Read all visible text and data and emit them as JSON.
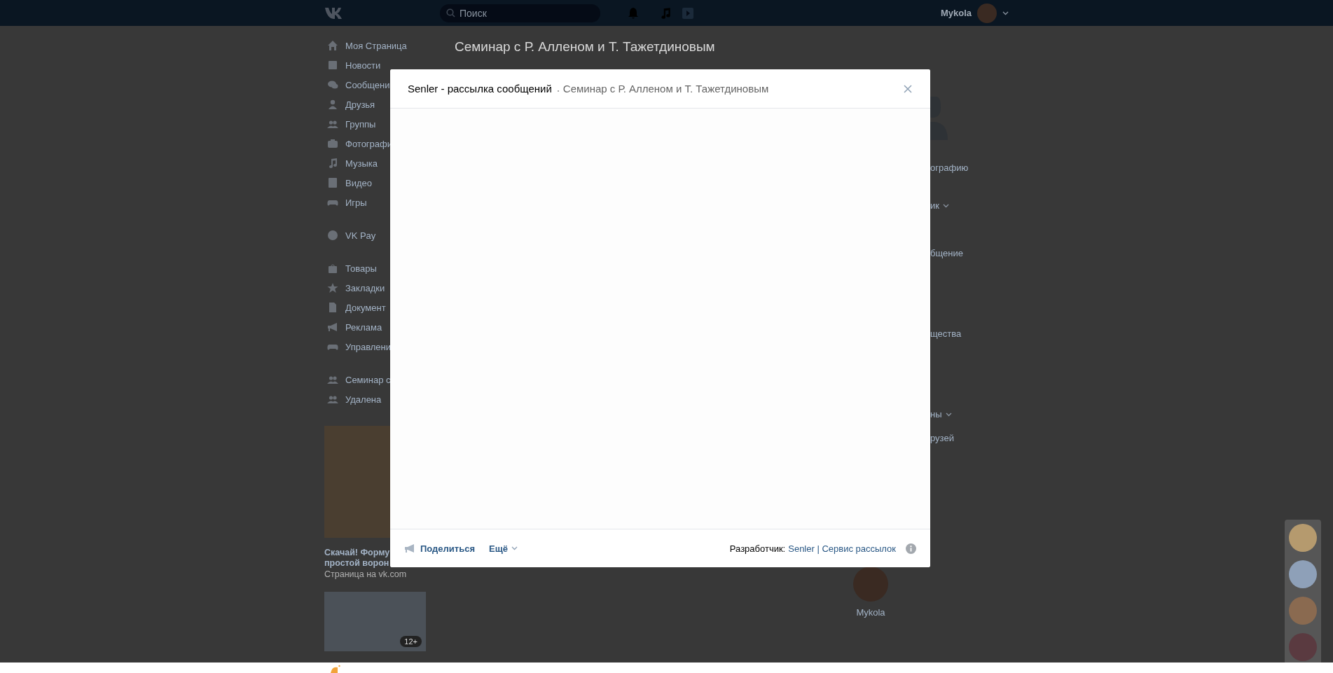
{
  "top_bar": {
    "search": {
      "placeholder": "Поиск"
    },
    "user_name": "Mykola"
  },
  "sidebar": {
    "groups": [
      {
        "items": [
          "Моя Страница",
          "Новости",
          "Сообщени",
          "Друзья",
          "Группы",
          "Фотографи",
          "Музыка",
          "Видео",
          "Игры"
        ]
      },
      {
        "items": [
          "VK Pay"
        ]
      },
      {
        "items": [
          "Товары",
          "Закладки",
          "Документ",
          "Реклама",
          "Управлени"
        ]
      },
      {
        "items": [
          "Семинар с",
          "Удалена"
        ]
      }
    ]
  },
  "ad": {
    "title_lines": [
      "Скачай! Форму",
      "простой ворон"
    ],
    "source": "Страница на vk.com"
  },
  "ad_2": {
    "badge": "12+"
  },
  "page_title": "Семинар с Р. Алленом и Т. Тажетдиновым",
  "right_column": {
    "items": [
      {
        "text": "ографию",
        "caret": false
      },
      {
        "text": "ик",
        "caret": true
      },
      {
        "text": "бщение",
        "caret": false
      },
      {
        "text": "щества",
        "caret": false
      },
      {
        "text": "ны",
        "caret": true
      },
      {
        "text": "рузей",
        "caret": false
      }
    ],
    "member": {
      "name": "Mykola"
    }
  },
  "modal": {
    "app_name": "Senler - рассылка сообщений",
    "community": "Семинар с Р. Алленом и Т. Тажетдиновым",
    "share": "Поделиться",
    "more": "Ещё",
    "developer_label": "Разработчик:",
    "developer_link": "Senler | Сервис рассылок"
  }
}
